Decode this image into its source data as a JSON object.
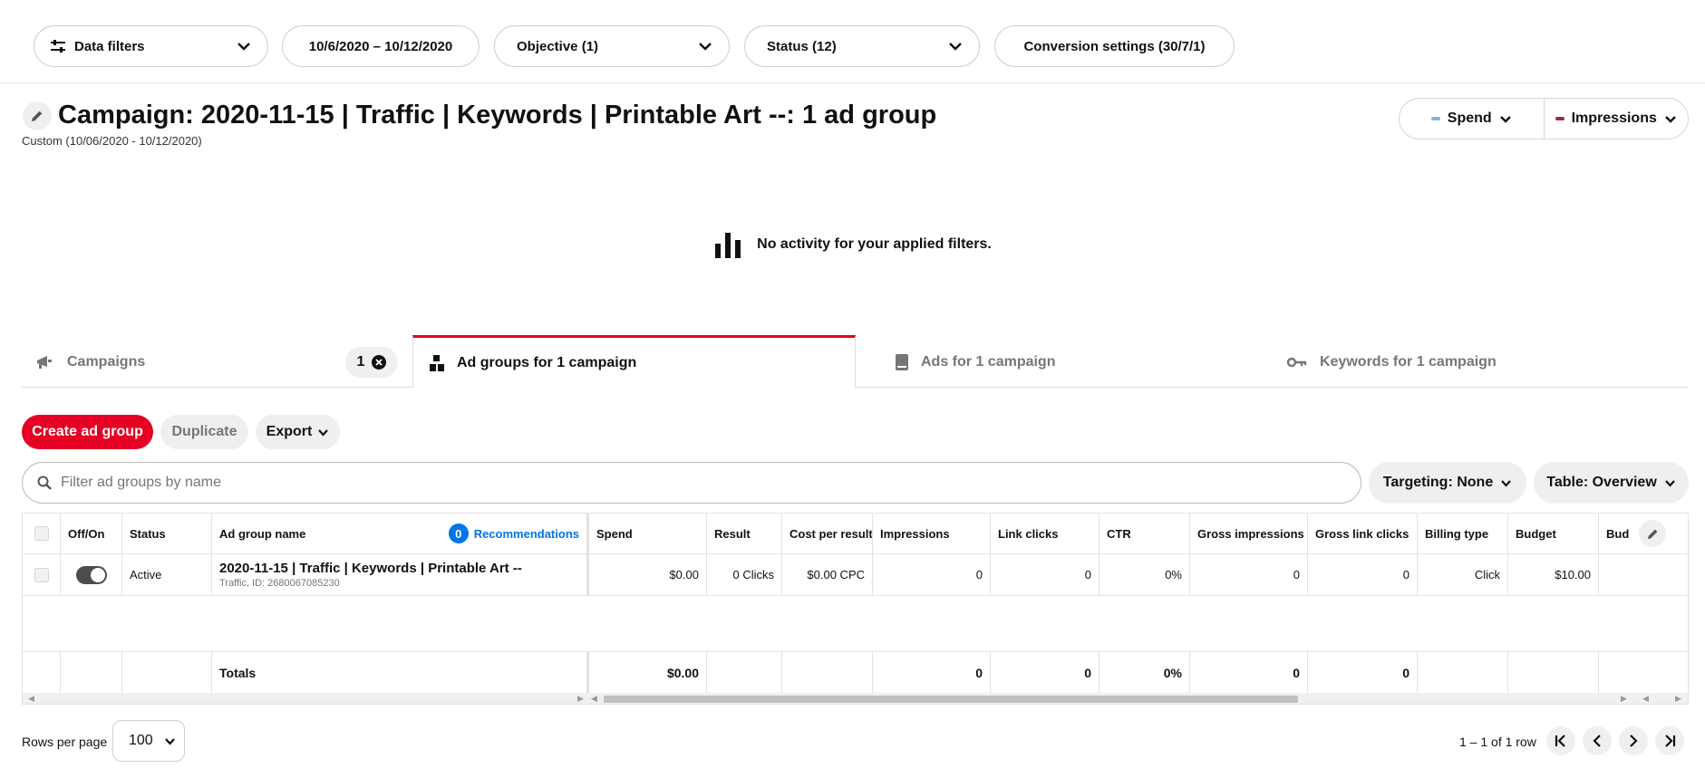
{
  "filters": {
    "data_filters": "Data filters",
    "date_range": "10/6/2020 – 10/12/2020",
    "objective": "Objective (1)",
    "status": "Status (12)",
    "conversion": "Conversion settings (30/7/1)"
  },
  "header": {
    "title": "Campaign: 2020-11-15 | Traffic | Keywords | Printable Art --: 1 ad group",
    "subtitle": "Custom (10/06/2020 - 10/12/2020)",
    "metric1": "Spend",
    "metric1_color": "#7fb5d5",
    "metric2": "Impressions",
    "metric2_color": "#9c2a58"
  },
  "chart": {
    "empty_message": "No activity for your applied filters."
  },
  "tabs": {
    "campaigns": "Campaigns",
    "campaigns_count": "1",
    "ad_groups": "Ad groups for 1 campaign",
    "ads": "Ads for 1 campaign",
    "keywords": "Keywords for 1 campaign"
  },
  "actions": {
    "create": "Create ad group",
    "duplicate": "Duplicate",
    "export": "Export"
  },
  "search": {
    "placeholder": "Filter ad groups by name"
  },
  "controls": {
    "targeting": "Targeting: None",
    "table": "Table: Overview"
  },
  "table": {
    "headers": {
      "offon": "Off/On",
      "status": "Status",
      "name": "Ad group name",
      "rec_count": "0",
      "recommendations": "Recommendations",
      "spend": "Spend",
      "result": "Result",
      "cpr": "Cost per result",
      "impressions": "Impressions",
      "link_clicks": "Link clicks",
      "ctr": "CTR",
      "gross_impressions": "Gross impressions",
      "gross_link_clicks": "Gross link clicks",
      "billing": "Billing type",
      "budget": "Budget",
      "bud_more": "Bud"
    },
    "row": {
      "status": "Active",
      "name": "2020-11-15 | Traffic | Keywords | Printable Art --",
      "meta": "Traffic, ID: 2680067085230",
      "spend": "$0.00",
      "result": "0 Clicks",
      "cpr": "$0.00 CPC",
      "impressions": "0",
      "link_clicks": "0",
      "ctr": "0%",
      "gross_impressions": "0",
      "gross_link_clicks": "0",
      "billing": "Click",
      "budget": "$10.00"
    },
    "totals": {
      "label": "Totals",
      "spend": "$0.00",
      "impressions": "0",
      "link_clicks": "0",
      "ctr": "0%",
      "gross_impressions": "0",
      "gross_link_clicks": "0"
    }
  },
  "footer": {
    "rows_per_page_label": "Rows per page",
    "rows_per_page": "100",
    "range": "1 – 1 of 1 row"
  }
}
